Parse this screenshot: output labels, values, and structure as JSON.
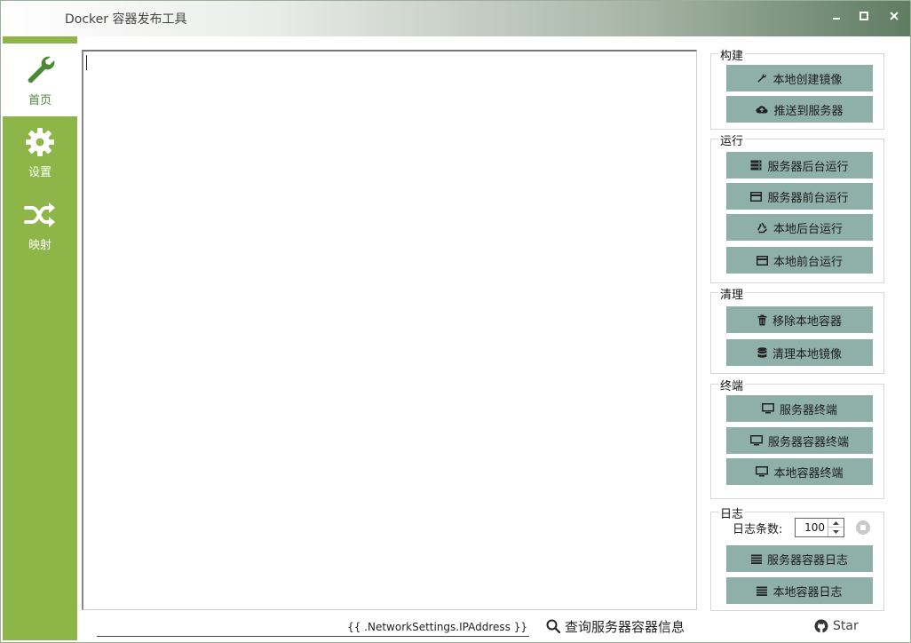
{
  "window": {
    "title": "Docker 容器发布工具",
    "minimize": "▁",
    "maximize": "□",
    "close": "✕"
  },
  "sidebar": {
    "items": [
      {
        "label": "首页",
        "icon": "wrench-icon",
        "active": true
      },
      {
        "label": "设置",
        "icon": "gear-icon",
        "active": false
      },
      {
        "label": "映射",
        "icon": "shuffle-icon",
        "active": false
      }
    ]
  },
  "groups": {
    "build": {
      "title": "构建",
      "buttons": [
        "本地创建镜像",
        "推送到服务器"
      ]
    },
    "run": {
      "title": "运行",
      "buttons": [
        "服务器后台运行",
        "服务器前台运行",
        "本地后台运行",
        "本地前台运行"
      ]
    },
    "clean": {
      "title": "清理",
      "buttons": [
        "移除本地容器",
        "清理本地镜像"
      ]
    },
    "terminal": {
      "title": "终端",
      "buttons": [
        "服务器终端",
        "服务器容器终端",
        "本地容器终端"
      ]
    },
    "log": {
      "title": "日志",
      "count_label": "日志条数:",
      "count_value": "100",
      "buttons": [
        "服务器容器日志",
        "本地容器日志"
      ]
    }
  },
  "bottom": {
    "format_value": "{{ .NetworkSettings.IPAddress }}",
    "query_label": "查询服务器容器信息",
    "star_label": "Star"
  },
  "colors": {
    "sidebar": "#8db548",
    "button": "#8fb0a8",
    "active_text": "#4a8a36"
  }
}
